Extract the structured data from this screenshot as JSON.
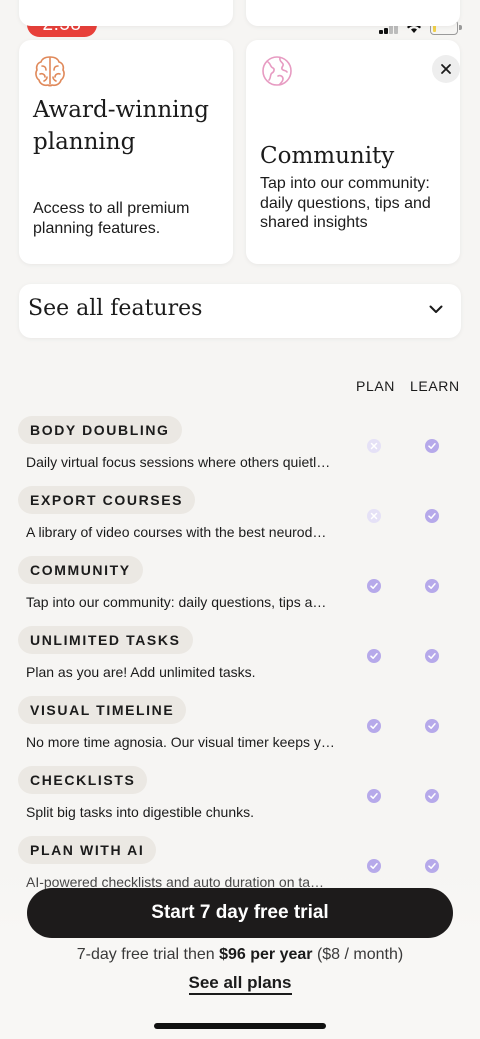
{
  "status_bar": {
    "time": "2:58",
    "battery_level": 0.15,
    "battery_color": "#f2d14a",
    "time_pill_color": "#e8403a"
  },
  "feature_cards": [
    {
      "icon": "brain-icon",
      "title": "Award-winning planning",
      "description": "Access to all premium planning features."
    },
    {
      "icon": "globe-icon",
      "title": "Community",
      "description": "Tap into our community: daily questions, tips and shared insights"
    }
  ],
  "see_all": {
    "label": "See all features"
  },
  "columns": {
    "plan": "PLAN",
    "learn": "LEARN"
  },
  "features": [
    {
      "name": "BODY DOUBLING",
      "description": "Daily virtual focus sessions where others quietl…",
      "plan": false,
      "learn": true
    },
    {
      "name": "EXPORT COURSES",
      "description": "A library of video courses with the best neurod…",
      "plan": false,
      "learn": true
    },
    {
      "name": "COMMUNITY",
      "description": "Tap into our community: daily questions, tips a…",
      "plan": true,
      "learn": true
    },
    {
      "name": "UNLIMITED TASKS",
      "description": "Plan as you are! Add unlimited tasks.",
      "plan": true,
      "learn": true
    },
    {
      "name": "VISUAL TIMELINE",
      "description": "No more time agnosia. Our visual timer keeps y…",
      "plan": true,
      "learn": true
    },
    {
      "name": "CHECKLISTS",
      "description": "Split big tasks into digestible chunks.",
      "plan": true,
      "learn": true
    },
    {
      "name": "PLAN WITH AI",
      "description": "AI-powered checklists and auto duration on ta…",
      "plan": true,
      "learn": true
    }
  ],
  "cta": {
    "button": "Start 7 day free trial",
    "price_prefix": "7-day free trial then",
    "price_bold": "$96 per year",
    "price_suffix": "($8 / month)",
    "see_plans": "See all plans"
  },
  "colors": {
    "accent": "#b6a9ea",
    "cta_bg": "#1d1b1b",
    "brain_icon": "#e0895a",
    "globe_icon": "#e79bc2"
  }
}
